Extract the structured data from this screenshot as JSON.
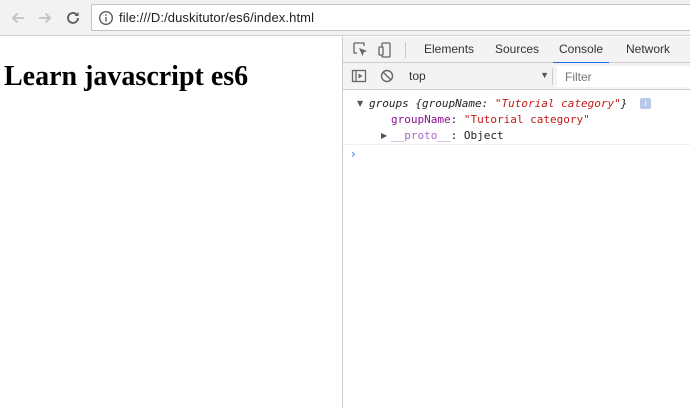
{
  "browser": {
    "url": "file:///D:/duskitutor/es6/index.html",
    "icons": [
      "back-arrow-icon",
      "forward-arrow-icon",
      "reload-icon",
      "info-icon"
    ]
  },
  "page": {
    "heading": "Learn javascript es6"
  },
  "devtools": {
    "tabs": [
      {
        "label": "Elements",
        "active": false
      },
      {
        "label": "Sources",
        "active": false
      },
      {
        "label": "Console",
        "active": true
      },
      {
        "label": "Network",
        "active": false
      }
    ],
    "context": "top",
    "filter_placeholder": "Filter",
    "console": {
      "object_name": "groups",
      "preview_open": "{groupName: ",
      "preview_value": "\"Tutorial category\"",
      "preview_close": "}",
      "info_badge": "i",
      "prop_key": "groupName",
      "prop_sep": ": ",
      "prop_value": "\"Tutorial category\"",
      "proto_key": "__proto__",
      "proto_value": "Object",
      "prompt": "›"
    },
    "accent_color": "#1a73e8"
  }
}
